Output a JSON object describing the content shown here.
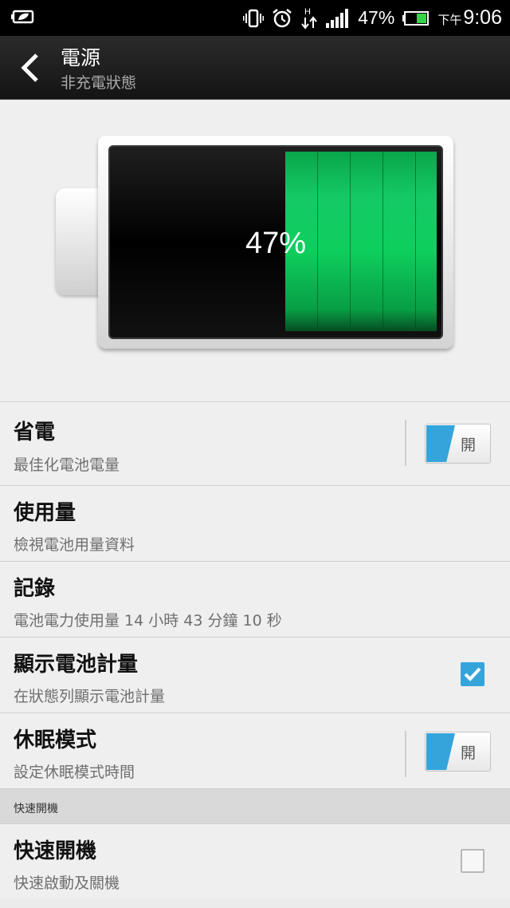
{
  "status_bar": {
    "battery_percent": "47%",
    "time_period": "下午",
    "time": "9:06",
    "icons": [
      "power-saver-icon",
      "vibrate-icon",
      "alarm-icon",
      "data-hspa-icon",
      "signal-icon",
      "battery-icon"
    ]
  },
  "action_bar": {
    "title": "電源",
    "subtitle": "非充電狀態"
  },
  "battery": {
    "level": 0.47,
    "label": "47%",
    "fill_color": "#14c964"
  },
  "settings": {
    "power_saver": {
      "title": "省電",
      "subtitle": "最佳化電池電量",
      "toggle_label": "開"
    },
    "usage": {
      "title": "使用量",
      "subtitle": "檢視電池用量資料"
    },
    "history": {
      "title": "記錄",
      "subtitle": "電池電力使用量 14 小時 43 分鐘 10 秒"
    },
    "show_battery": {
      "title": "顯示電池計量",
      "subtitle": "在狀態列顯示電池計量",
      "checked": true
    },
    "sleep_mode": {
      "title": "休眠模式",
      "subtitle": "設定休眠模式時間",
      "toggle_label": "開"
    },
    "fast_boot_section": {
      "header": "快速開機"
    },
    "fast_boot": {
      "title": "快速開機",
      "subtitle": "快速啟動及關機",
      "checked": false
    }
  },
  "colors": {
    "accent": "#35a4db",
    "battery_green": "#14c964"
  }
}
